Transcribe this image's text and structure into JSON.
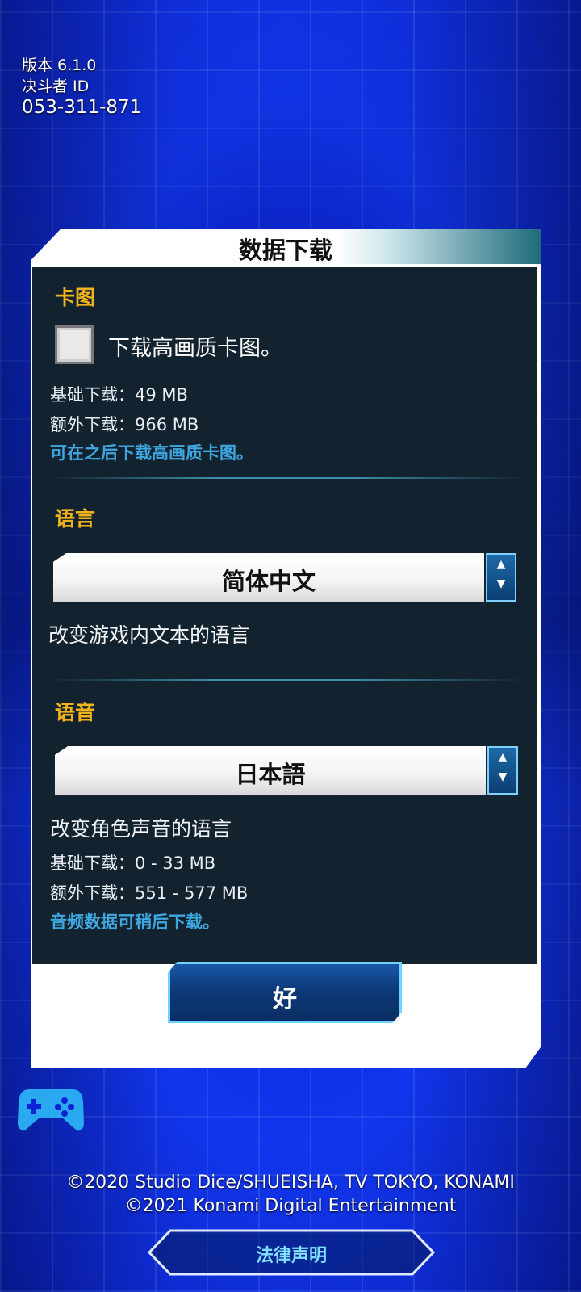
{
  "top_info": {
    "version": "版本 6.1.0",
    "duelist_id_label": "决斗者 ID",
    "duelist_id": "053-311-871"
  },
  "dialog": {
    "title": "数据下载",
    "card_section": {
      "title": "卡图",
      "checkbox_label": "下载高画质卡图。",
      "checked": false,
      "base_download": "基础下载：49 MB",
      "extra_download": "额外下载：966 MB",
      "note": "可在之后下载高画质卡图。"
    },
    "language_section": {
      "title": "语言",
      "selected": "简体中文",
      "description": "改变游戏内文本的语言"
    },
    "voice_section": {
      "title": "语音",
      "selected": "日本語",
      "description": "改变角色声音的语言",
      "base_download": "基础下载：0 - 33 MB",
      "extra_download": "额外下载：551 - 577 MB",
      "note": "音频数据可稍后下载。"
    },
    "ok_label": "好"
  },
  "footer": {
    "copyright_line1": "©2020 Studio Dice/SHUEISHA, TV TOKYO, KONAMI",
    "copyright_line2": "©2021 Konami Digital Entertainment",
    "legal_label": "法律声明"
  },
  "colors": {
    "accent_yellow": "#f2b21a",
    "note_blue": "#3fa7e0",
    "panel_dark": "#13222f",
    "gamepad_blue": "#2aa8f0"
  },
  "icons": {
    "gamepad": "gamepad-icon",
    "spinner": "up-down-arrows-icon"
  }
}
